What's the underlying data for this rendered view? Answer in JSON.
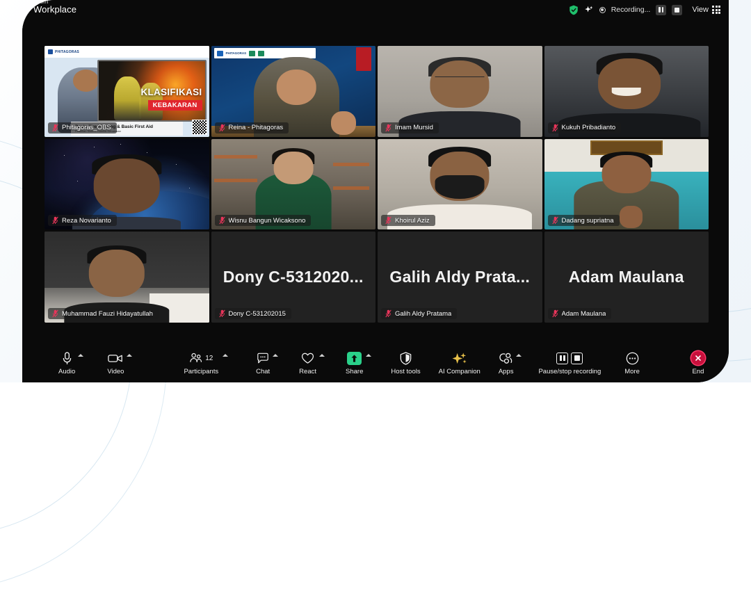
{
  "app": {
    "brand_small": "zoom",
    "brand_main": "Workplace"
  },
  "topbar": {
    "shield_icon": "shield-encryption-icon",
    "ai_icon": "ai-companion-sparkle-icon",
    "recording_dot_icon": "recording-indicator-icon",
    "recording_label": "Recording...",
    "pause_icon": "pause-recording-icon",
    "stop_icon": "stop-recording-icon",
    "view_label": "View",
    "view_icon": "grid-view-icon"
  },
  "grid": {
    "participants": [
      {
        "name": "Phitagoras_OBS",
        "muted": true,
        "active_speaker": true,
        "type": "video",
        "slide": {
          "title": "KLASIFIKASI",
          "subtitle": "KEBAKARAN",
          "lower_third_title": "Basic Fire Fighting & Basic First Aid",
          "lower_third_sub": "Pelatihan Sistem Proteksi Kebakaran",
          "banner_brand": "PHITAGORAS"
        }
      },
      {
        "name": "Reina - Phitagoras",
        "muted": true,
        "active_speaker": false,
        "type": "video",
        "banner_brand": "PHITAGORAS"
      },
      {
        "name": "Imam Mursid",
        "muted": true,
        "active_speaker": false,
        "type": "video"
      },
      {
        "name": "Kukuh Pribadianto",
        "muted": true,
        "active_speaker": false,
        "type": "video"
      },
      {
        "name": "Reza Novarianto",
        "muted": true,
        "active_speaker": false,
        "type": "video"
      },
      {
        "name": "Wisnu Bangun Wicaksono",
        "muted": true,
        "active_speaker": false,
        "type": "video"
      },
      {
        "name": "Khoirul Aziz",
        "muted": true,
        "active_speaker": false,
        "type": "video"
      },
      {
        "name": "Dadang supriatna",
        "muted": true,
        "active_speaker": false,
        "type": "video"
      },
      {
        "name": "Muhammad Fauzi Hidayatullah",
        "muted": true,
        "active_speaker": false,
        "type": "video"
      },
      {
        "name": "Dony C-531202015",
        "muted": true,
        "active_speaker": false,
        "type": "name",
        "display_name": "Dony  C-5312020..."
      },
      {
        "name": "Galih Aldy Pratama",
        "muted": true,
        "active_speaker": false,
        "type": "name",
        "display_name": "Galih  Aldy  Prata..."
      },
      {
        "name": "Adam Maulana",
        "muted": true,
        "active_speaker": false,
        "type": "name",
        "display_name": "Adam Maulana"
      }
    ]
  },
  "toolbar": {
    "items": [
      {
        "label": "Audio",
        "icon": "microphone-icon",
        "caret": true
      },
      {
        "label": "Video",
        "icon": "camera-icon",
        "caret": true
      },
      {
        "label": "Participants",
        "icon": "participants-icon",
        "caret": true,
        "count": "12"
      },
      {
        "label": "Chat",
        "icon": "chat-bubble-icon",
        "caret": true
      },
      {
        "label": "React",
        "icon": "heart-react-icon",
        "caret": true
      },
      {
        "label": "Share",
        "icon": "share-screen-icon",
        "caret": true
      },
      {
        "label": "Host tools",
        "icon": "shield-host-tools-icon",
        "caret": false
      },
      {
        "label": "AI Companion",
        "icon": "ai-companion-sparkle-icon",
        "caret": false
      },
      {
        "label": "Apps",
        "icon": "apps-icon",
        "caret": true
      },
      {
        "label": "Pause/stop recording",
        "icon": "pause-stop-recording-icon",
        "caret": false
      },
      {
        "label": "More",
        "icon": "more-ellipsis-icon",
        "caret": false
      },
      {
        "label": "End",
        "icon": "end-call-icon",
        "caret": false
      }
    ]
  },
  "colors": {
    "accent_green": "#2ad08a",
    "end_red": "#c8103c",
    "ai_gold": "#e8c14a",
    "window_bg": "#0a0a0a",
    "slide_red": "#e0252d"
  }
}
